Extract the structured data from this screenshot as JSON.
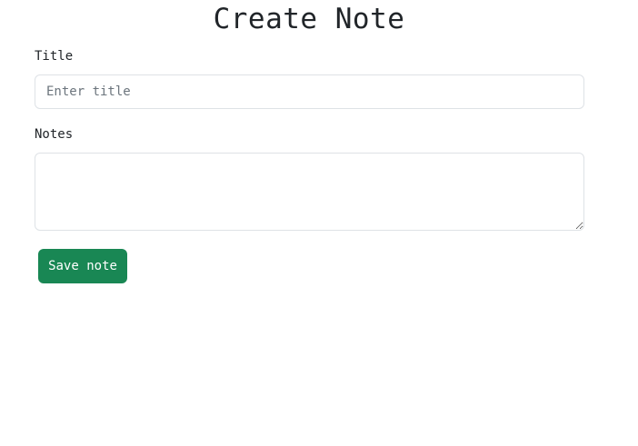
{
  "page": {
    "heading": "Create Note"
  },
  "form": {
    "title_label": "Title",
    "title_placeholder": "Enter title",
    "title_value": "",
    "notes_label": "Notes",
    "notes_value": "",
    "save_label": "Save note"
  },
  "colors": {
    "save_button_bg": "#198754",
    "input_border": "#dee2e6"
  }
}
